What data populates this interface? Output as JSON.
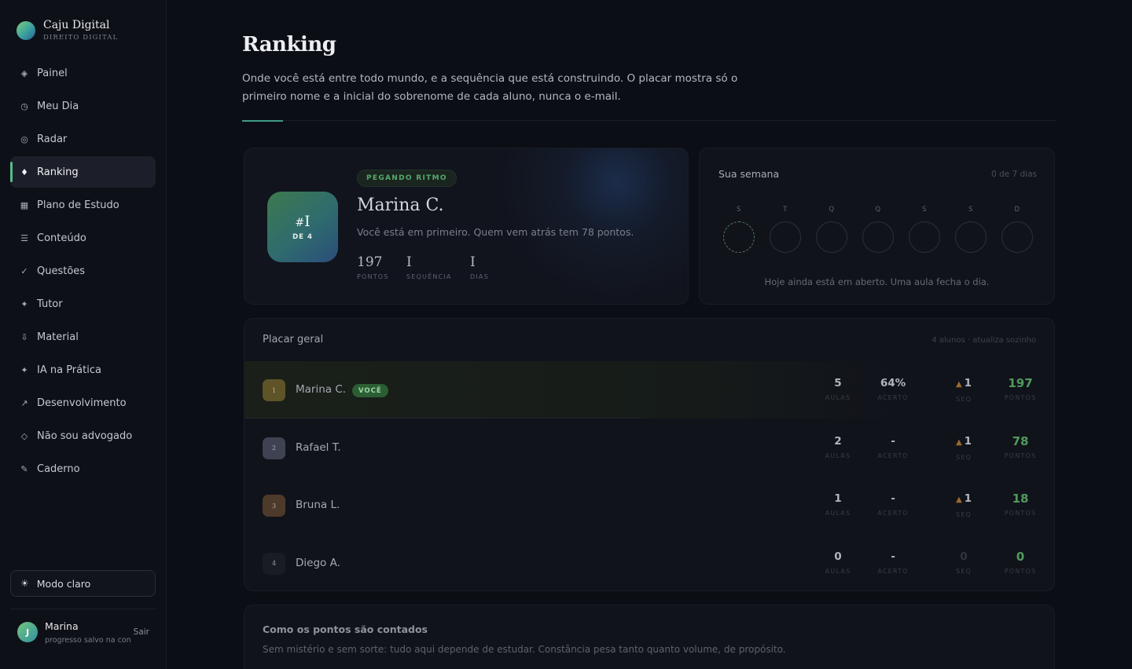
{
  "brand": {
    "name": "Caju Digital",
    "subtitle": "DIREITO DIGITAL"
  },
  "nav": [
    {
      "label": "Painel",
      "icon": "diamond-icon",
      "glyph": "◈"
    },
    {
      "label": "Meu Dia",
      "icon": "clock-icon",
      "glyph": "◷"
    },
    {
      "label": "Radar",
      "icon": "target-icon",
      "glyph": "◎"
    },
    {
      "label": "Ranking",
      "icon": "diamond-solid-icon",
      "glyph": "♦",
      "active": true
    },
    {
      "label": "Plano de Estudo",
      "icon": "grid-icon",
      "glyph": "▦"
    },
    {
      "label": "Conteúdo",
      "icon": "list-icon",
      "glyph": "☰"
    },
    {
      "label": "Questões",
      "icon": "check-icon",
      "glyph": "✓"
    },
    {
      "label": "Tutor",
      "icon": "sparkle-icon",
      "glyph": "✦"
    },
    {
      "label": "Material",
      "icon": "download-icon",
      "glyph": "⇩"
    },
    {
      "label": "IA na Prática",
      "icon": "sparkle-icon",
      "glyph": "✦"
    },
    {
      "label": "Desenvolvimento",
      "icon": "trend-arrow-icon",
      "glyph": "↗"
    },
    {
      "label": "Não sou advogado",
      "icon": "diamond-outline-icon",
      "glyph": "◇"
    },
    {
      "label": "Caderno",
      "icon": "pencil-icon",
      "glyph": "✎"
    }
  ],
  "mode_button": {
    "label": "Modo claro",
    "icon": "sun-icon",
    "glyph": "☀"
  },
  "user": {
    "initial": "J",
    "name": "Marina",
    "subtitle": "progresso salvo na cont",
    "logout": "Sair"
  },
  "page": {
    "title": "Ranking",
    "description": "Onde você está entre todo mundo, e a sequência que está construindo. O placar mostra só o primeiro nome e a inicial do sobrenome de cada aluno, nunca o e-mail."
  },
  "hero": {
    "rank_number": "I",
    "rank_of": "DE 4",
    "stage": "PEGANDO RITMO",
    "name": "Marina C.",
    "message": "Você está em primeiro. Quem vem atrás tem 78 pontos.",
    "stats": [
      {
        "value": "197",
        "label": "PONTOS"
      },
      {
        "value": "I",
        "label": "SEQUÊNCIA"
      },
      {
        "value": "I",
        "label": "DIAS"
      }
    ]
  },
  "week": {
    "title": "Sua semana",
    "count": "0 de 7 dias",
    "days": [
      "S",
      "T",
      "Q",
      "Q",
      "S",
      "S",
      "D"
    ],
    "today_index": 0,
    "note": "Hoje ainda está em aberto. Uma aula fecha o dia."
  },
  "board": {
    "title": "Placar geral",
    "meta": "4 alunos · atualiza sozinho",
    "you_label": "VOCÊ",
    "labels": {
      "aulas": "AULAS",
      "acerto": "ACERTO",
      "seq": "SEQ",
      "pontos": "PONTOS"
    },
    "rows": [
      {
        "rank": "1",
        "name": "Marina C.",
        "you": true,
        "aulas": "5",
        "acerto": "64%",
        "seq": "1",
        "seq_active": true,
        "pontos": "197",
        "rank_color": "#5e5428"
      },
      {
        "rank": "2",
        "name": "Rafael T.",
        "you": false,
        "aulas": "2",
        "acerto": "-",
        "seq": "1",
        "seq_active": true,
        "pontos": "78",
        "rank_color": "#3e4251"
      },
      {
        "rank": "3",
        "name": "Bruna L.",
        "you": false,
        "aulas": "1",
        "acerto": "-",
        "seq": "1",
        "seq_active": true,
        "pontos": "18",
        "rank_color": "#4e3a2a"
      },
      {
        "rank": "4",
        "name": "Diego A.",
        "you": false,
        "aulas": "0",
        "acerto": "-",
        "seq": "0",
        "seq_active": false,
        "pontos": "0",
        "rank_color": "#191c24"
      }
    ]
  },
  "how": {
    "title": "Como os pontos são contados",
    "description": "Sem mistério e sem sorte: tudo aqui depende de estudar. Constância pesa tanto quanto volume, de propósito."
  }
}
